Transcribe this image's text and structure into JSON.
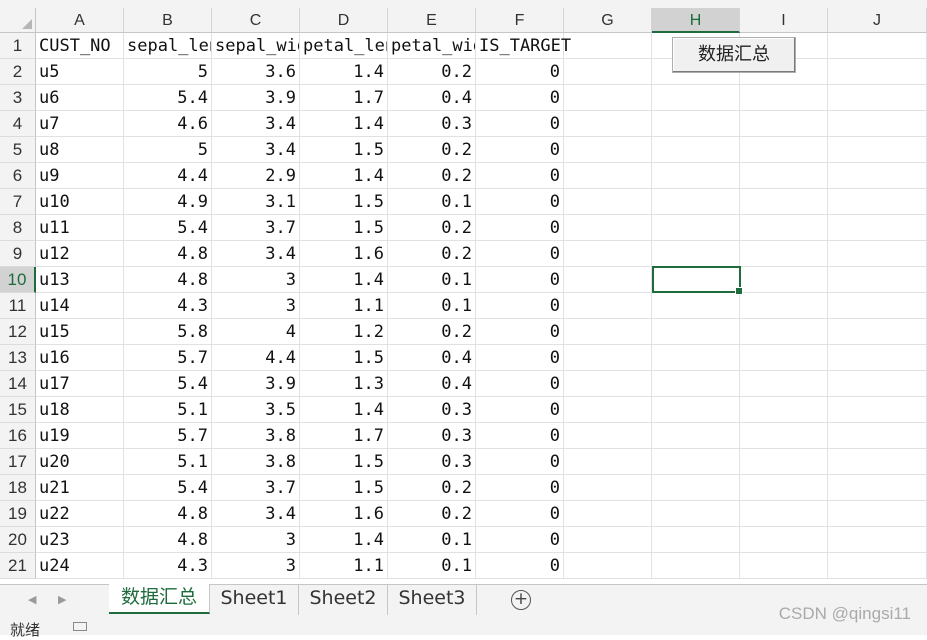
{
  "columns": [
    "A",
    "B",
    "C",
    "D",
    "E",
    "F",
    "G",
    "H",
    "I",
    "J"
  ],
  "active_column": "H",
  "active_row": "10",
  "header_row": {
    "row_num": "1",
    "cells": [
      "CUST_NO",
      "sepal_length",
      "sepal_width",
      "petal_length",
      "petal_width",
      "IS_TARGET"
    ]
  },
  "rows": [
    {
      "n": "2",
      "id": "u5",
      "sl": "5",
      "sw": "3.6",
      "pl": "1.4",
      "pw": "0.2",
      "t": "0"
    },
    {
      "n": "3",
      "id": "u6",
      "sl": "5.4",
      "sw": "3.9",
      "pl": "1.7",
      "pw": "0.4",
      "t": "0"
    },
    {
      "n": "4",
      "id": "u7",
      "sl": "4.6",
      "sw": "3.4",
      "pl": "1.4",
      "pw": "0.3",
      "t": "0"
    },
    {
      "n": "5",
      "id": "u8",
      "sl": "5",
      "sw": "3.4",
      "pl": "1.5",
      "pw": "0.2",
      "t": "0"
    },
    {
      "n": "6",
      "id": "u9",
      "sl": "4.4",
      "sw": "2.9",
      "pl": "1.4",
      "pw": "0.2",
      "t": "0"
    },
    {
      "n": "7",
      "id": "u10",
      "sl": "4.9",
      "sw": "3.1",
      "pl": "1.5",
      "pw": "0.1",
      "t": "0"
    },
    {
      "n": "8",
      "id": "u11",
      "sl": "5.4",
      "sw": "3.7",
      "pl": "1.5",
      "pw": "0.2",
      "t": "0"
    },
    {
      "n": "9",
      "id": "u12",
      "sl": "4.8",
      "sw": "3.4",
      "pl": "1.6",
      "pw": "0.2",
      "t": "0"
    },
    {
      "n": "10",
      "id": "u13",
      "sl": "4.8",
      "sw": "3",
      "pl": "1.4",
      "pw": "0.1",
      "t": "0"
    },
    {
      "n": "11",
      "id": "u14",
      "sl": "4.3",
      "sw": "3",
      "pl": "1.1",
      "pw": "0.1",
      "t": "0"
    },
    {
      "n": "12",
      "id": "u15",
      "sl": "5.8",
      "sw": "4",
      "pl": "1.2",
      "pw": "0.2",
      "t": "0"
    },
    {
      "n": "13",
      "id": "u16",
      "sl": "5.7",
      "sw": "4.4",
      "pl": "1.5",
      "pw": "0.4",
      "t": "0"
    },
    {
      "n": "14",
      "id": "u17",
      "sl": "5.4",
      "sw": "3.9",
      "pl": "1.3",
      "pw": "0.4",
      "t": "0"
    },
    {
      "n": "15",
      "id": "u18",
      "sl": "5.1",
      "sw": "3.5",
      "pl": "1.4",
      "pw": "0.3",
      "t": "0"
    },
    {
      "n": "16",
      "id": "u19",
      "sl": "5.7",
      "sw": "3.8",
      "pl": "1.7",
      "pw": "0.3",
      "t": "0"
    },
    {
      "n": "17",
      "id": "u20",
      "sl": "5.1",
      "sw": "3.8",
      "pl": "1.5",
      "pw": "0.3",
      "t": "0"
    },
    {
      "n": "18",
      "id": "u21",
      "sl": "5.4",
      "sw": "3.7",
      "pl": "1.5",
      "pw": "0.2",
      "t": "0"
    },
    {
      "n": "19",
      "id": "u22",
      "sl": "4.8",
      "sw": "3.4",
      "pl": "1.6",
      "pw": "0.2",
      "t": "0"
    },
    {
      "n": "20",
      "id": "u23",
      "sl": "4.8",
      "sw": "3",
      "pl": "1.4",
      "pw": "0.1",
      "t": "0"
    },
    {
      "n": "21",
      "id": "u24",
      "sl": "4.3",
      "sw": "3",
      "pl": "1.1",
      "pw": "0.1",
      "t": "0"
    }
  ],
  "macro_button": {
    "label": "数据汇总"
  },
  "sheet_tabs": [
    "数据汇总",
    "Sheet1",
    "Sheet2",
    "Sheet3"
  ],
  "active_tab": "数据汇总",
  "add_sheet": {
    "label": "+"
  },
  "status": {
    "text": "就绪"
  },
  "watermark": "CSDN @qingsi11",
  "colors": {
    "accent": "#1e6b3c",
    "header_bg": "#f3f3f3",
    "gridline": "#e1e1e1"
  }
}
